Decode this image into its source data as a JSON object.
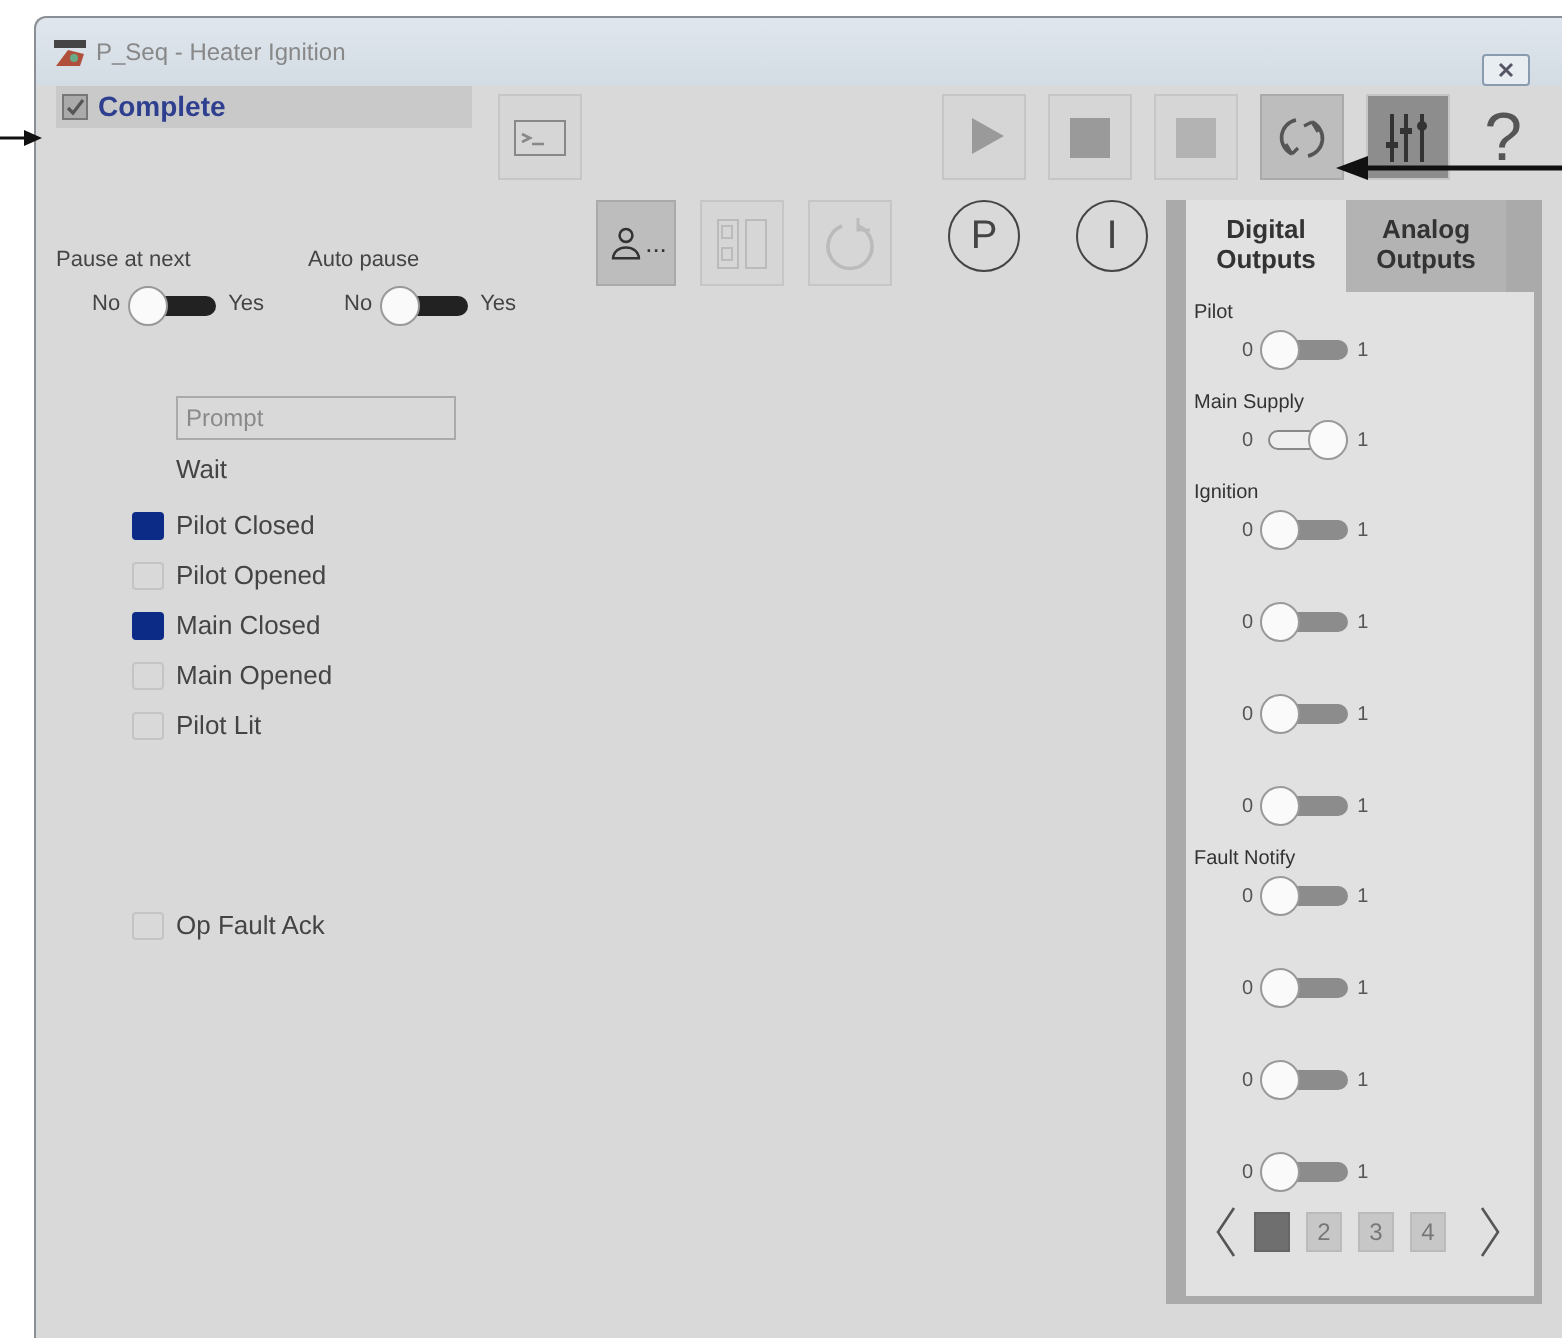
{
  "window": {
    "title": "P_Seq - Heater Ignition"
  },
  "status": {
    "label": "Complete",
    "checked": true
  },
  "toolbar": [
    {
      "kind": "play",
      "pressed": false
    },
    {
      "kind": "stop",
      "pressed": false
    },
    {
      "kind": "abort",
      "pressed": false
    },
    {
      "kind": "reset",
      "pressed": true
    },
    {
      "kind": "sliders",
      "pressed": true
    }
  ],
  "help": "?",
  "mode_buttons": [
    {
      "kind": "operator",
      "text": "...",
      "pressed": true
    },
    {
      "kind": "panels",
      "pressed": false
    },
    {
      "kind": "undo",
      "pressed": false
    },
    {
      "kind": "letter",
      "text": "P"
    },
    {
      "kind": "letter",
      "text": "I"
    }
  ],
  "pause_toggles": [
    {
      "label": "Pause at next",
      "off_label": "No",
      "on_label": "Yes",
      "on": false
    },
    {
      "label": "Auto pause",
      "off_label": "No",
      "on_label": "Yes",
      "on": false
    }
  ],
  "prompt": {
    "placeholder": "Prompt"
  },
  "wait": "Wait",
  "indicators": [
    {
      "label": "Pilot Closed",
      "on": true
    },
    {
      "label": "Pilot Opened",
      "on": false
    },
    {
      "label": "Main Closed",
      "on": true
    },
    {
      "label": "Main Opened",
      "on": false
    },
    {
      "label": "Pilot Lit",
      "on": false
    }
  ],
  "fault_ack": {
    "label": "Op Fault Ack",
    "on": false
  },
  "tabs": [
    {
      "label": "Digital Outputs",
      "selected": true
    },
    {
      "label": "Analog Outputs",
      "selected": false
    }
  ],
  "outputs": [
    {
      "label": "Pilot",
      "low": "0",
      "high": "1",
      "on": false
    },
    {
      "label": "Main Supply",
      "low": "0",
      "high": "1",
      "on": true
    },
    {
      "label": "Ignition",
      "low": "0",
      "high": "1",
      "on": false
    },
    {
      "low": "0",
      "high": "1",
      "on": false
    },
    {
      "low": "0",
      "high": "1",
      "on": false
    },
    {
      "low": "0",
      "high": "1",
      "on": false
    },
    {
      "label": "Fault Notify",
      "low": "0",
      "high": "1",
      "on": false
    },
    {
      "low": "0",
      "high": "1",
      "on": false
    },
    {
      "low": "0",
      "high": "1",
      "on": false
    },
    {
      "low": "0",
      "high": "1",
      "on": false
    }
  ],
  "pages": [
    {
      "selected": true
    },
    {
      "label": "2",
      "selected": false
    },
    {
      "label": "3",
      "selected": false
    },
    {
      "label": "4",
      "selected": false
    }
  ]
}
